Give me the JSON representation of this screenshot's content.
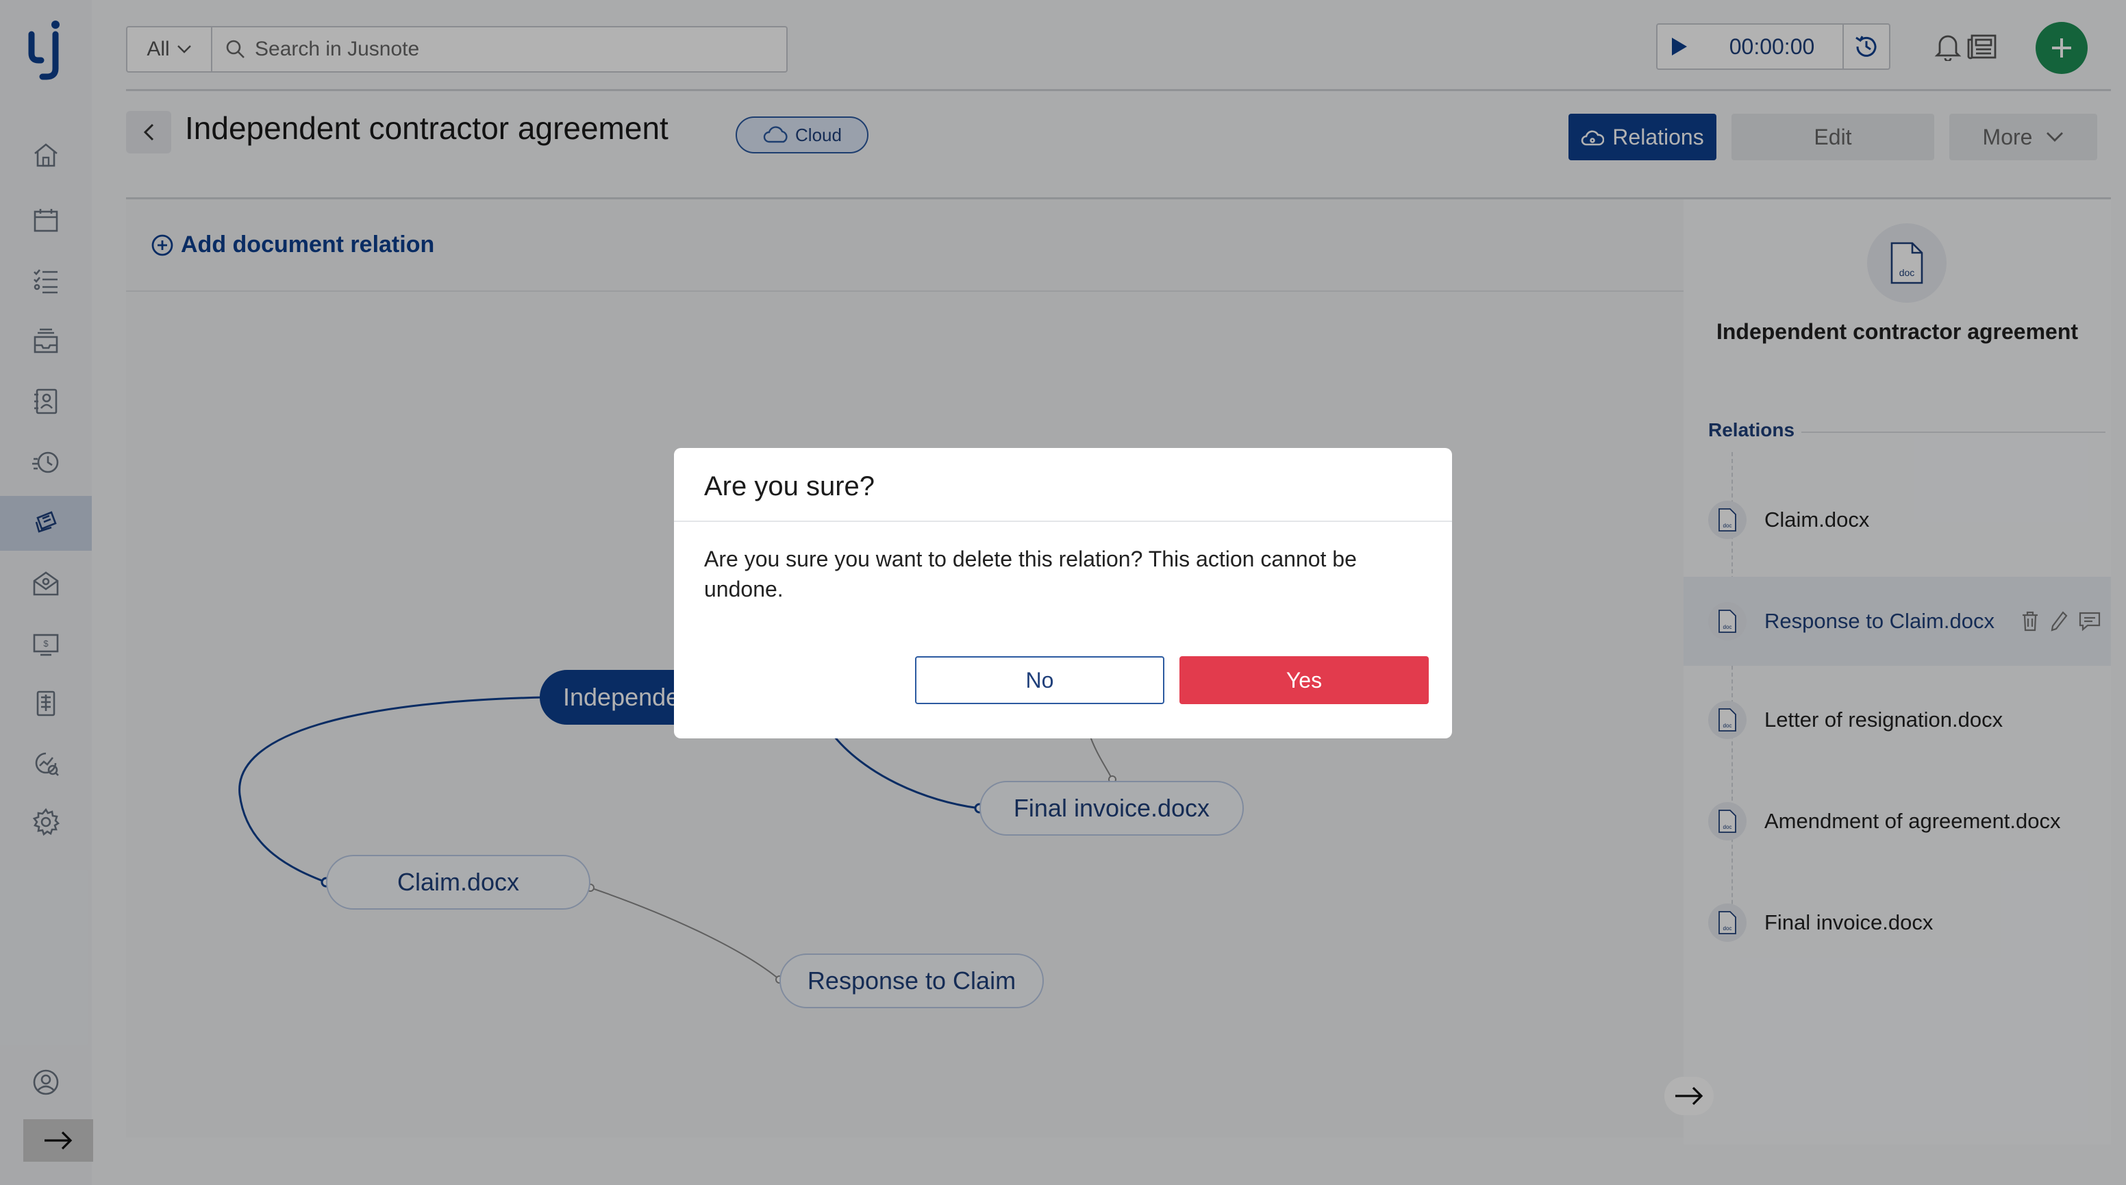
{
  "search": {
    "filter_label": "All",
    "placeholder": "Search in Jusnote"
  },
  "timer": {
    "value": "00:00:00"
  },
  "header": {
    "title": "Independent contractor agreement",
    "storage_badge": "Cloud",
    "relations_label": "Relations",
    "edit_label": "Edit",
    "more_label": "More"
  },
  "canvas": {
    "add_relation_label": "Add document relation",
    "nodes": {
      "main": "Independent contractor agreement",
      "final_invoice": "Final invoice.docx",
      "claim": "Claim.docx",
      "response": "Response to Claim"
    }
  },
  "panel": {
    "doc_icon_label": "doc",
    "document_title": "Independent contractor agreement",
    "relations_heading": "Relations",
    "relations": [
      {
        "name": "Claim.docx"
      },
      {
        "name": "Response to Claim.docx"
      },
      {
        "name": "Letter of resignation.docx"
      },
      {
        "name": "Amendment of agreement.docx"
      },
      {
        "name": "Final invoice.docx"
      }
    ]
  },
  "dialog": {
    "title": "Are you sure?",
    "message": "Are you sure you want to delete this relation? This action cannot be undone.",
    "no_label": "No",
    "yes_label": "Yes"
  },
  "colors": {
    "primary": "#0e3f8f",
    "danger": "#e23b4d",
    "success": "#1e8f55",
    "overlay": "rgba(0,0,0,0.30)"
  },
  "nav_icons": [
    "home-icon",
    "calendar-icon",
    "tasks-icon",
    "inbox-icon",
    "contacts-icon",
    "time-tracking-icon",
    "documents-icon",
    "mail-icon",
    "billing-icon",
    "reports-icon",
    "analytics-icon",
    "settings-icon",
    "profile-icon",
    "expand-arrow-icon"
  ]
}
